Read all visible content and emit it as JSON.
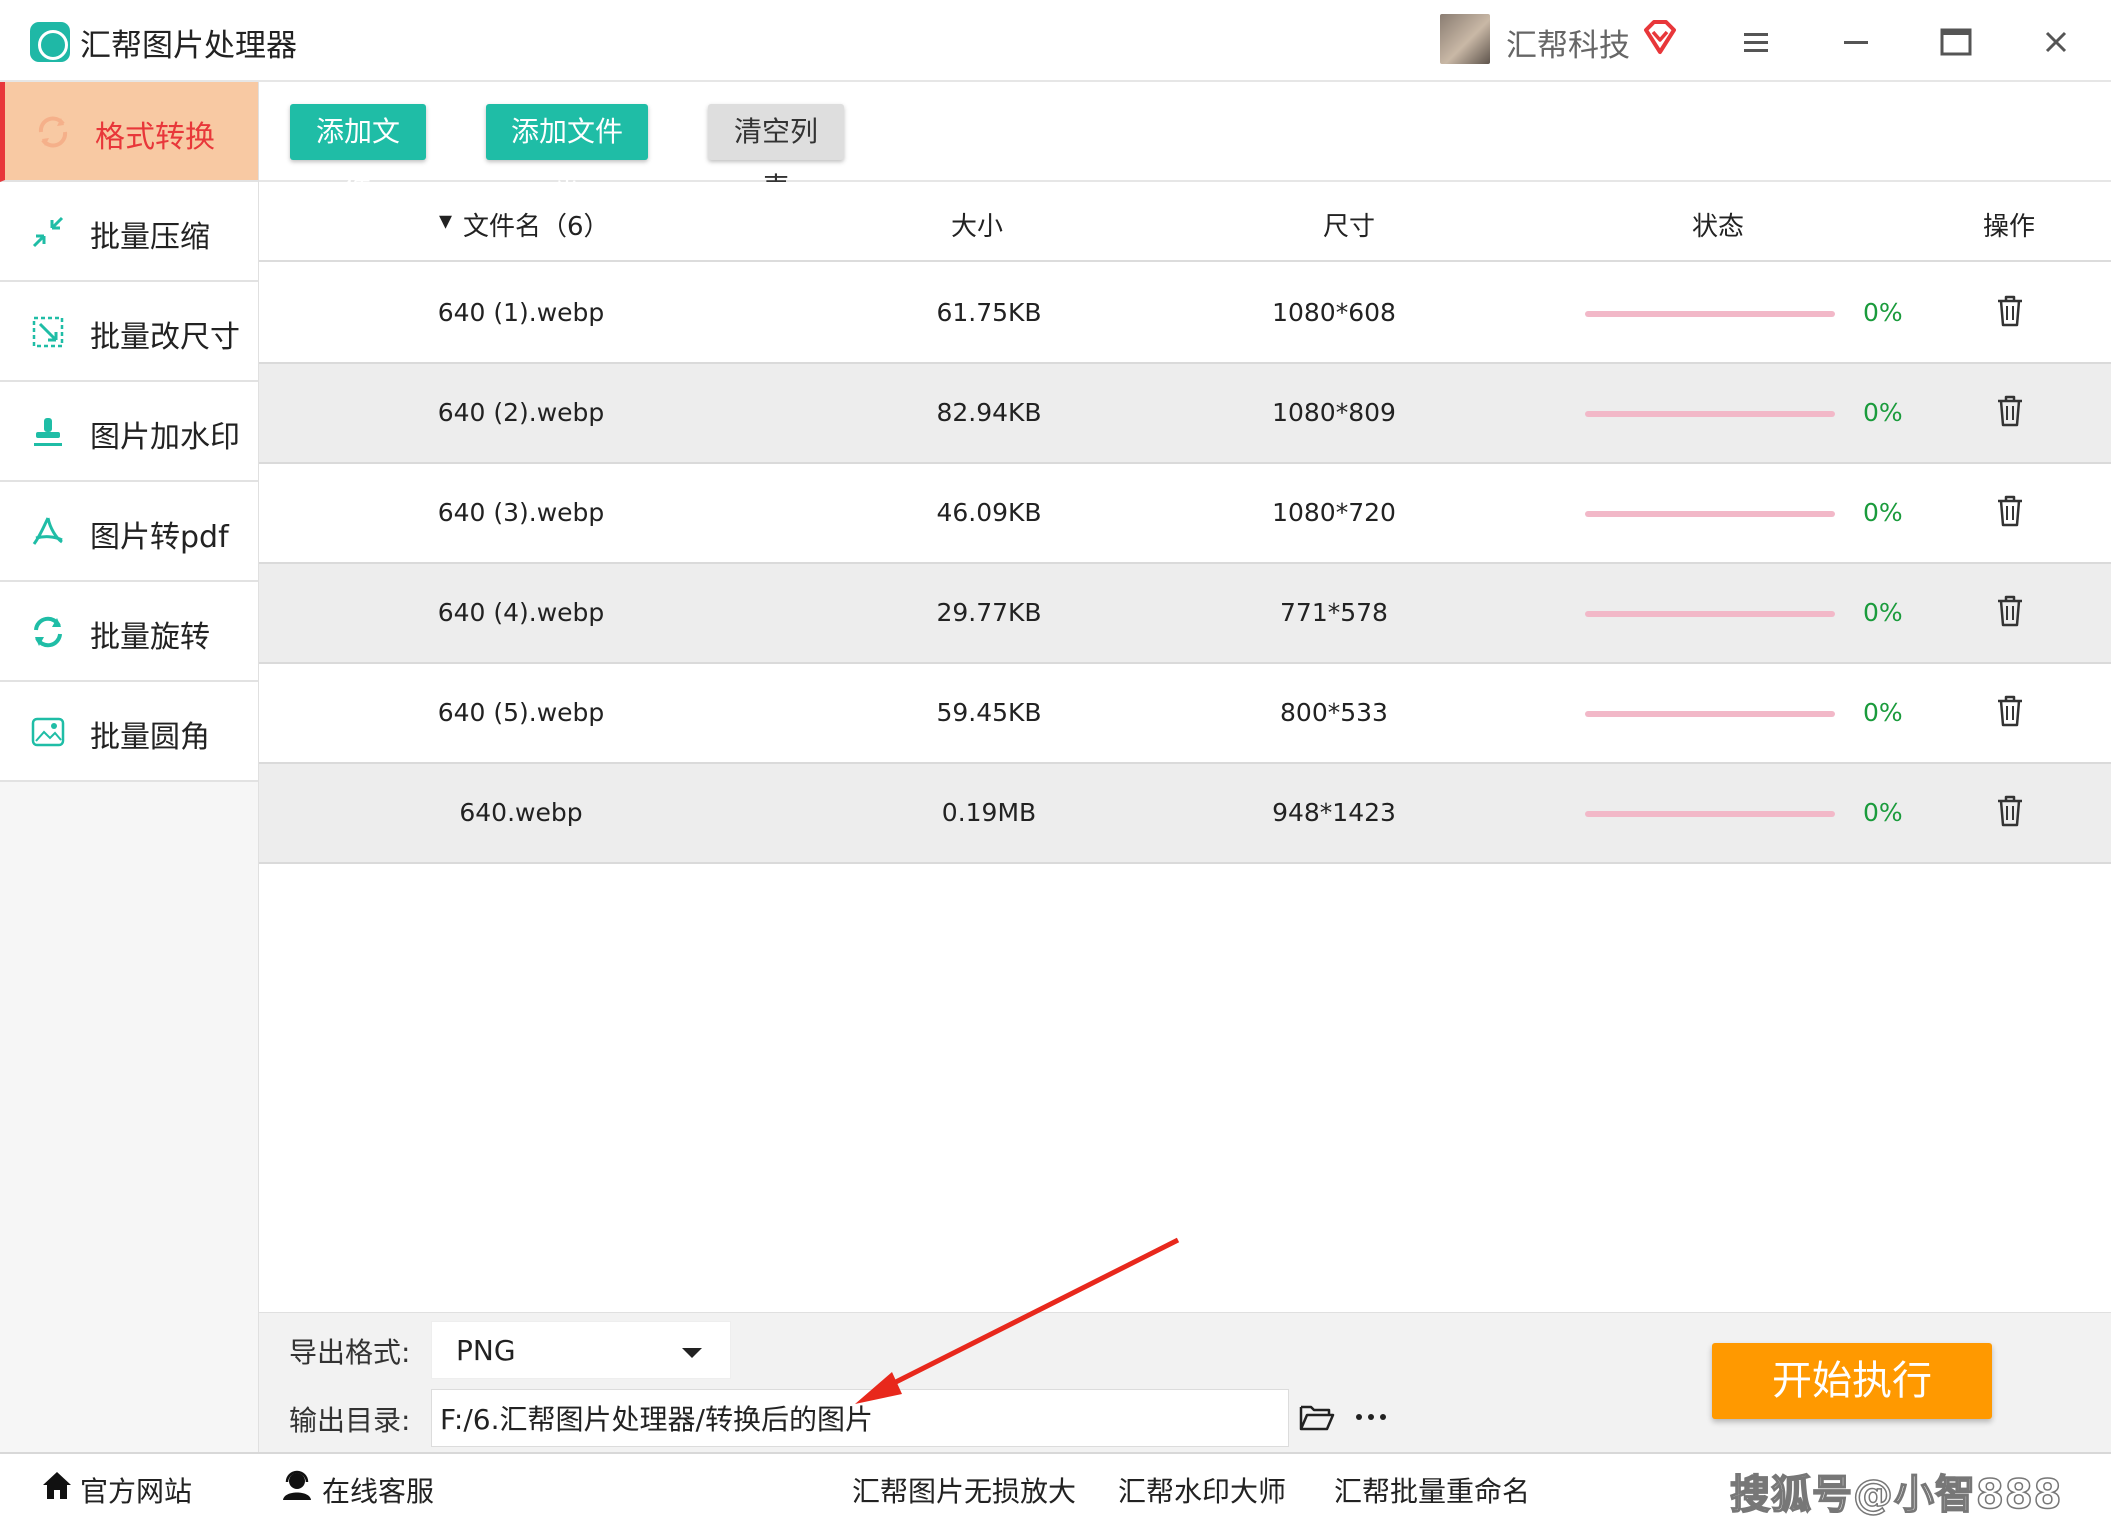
{
  "app": {
    "title": "汇帮图片处理器"
  },
  "user": {
    "name": "汇帮科技"
  },
  "sidebar": {
    "items": [
      {
        "label": "格式转换",
        "icon": "format-convert-icon",
        "active": true
      },
      {
        "label": "批量压缩",
        "icon": "compress-icon"
      },
      {
        "label": "批量改尺寸",
        "icon": "resize-icon"
      },
      {
        "label": "图片加水印",
        "icon": "watermark-stamp-icon"
      },
      {
        "label": "图片转pdf",
        "icon": "pdf-icon"
      },
      {
        "label": "批量旋转",
        "icon": "rotate-icon"
      },
      {
        "label": "批量圆角",
        "icon": "round-corner-icon"
      }
    ]
  },
  "toolbar": {
    "add_file": "添加文件",
    "add_folder": "添加文件夹",
    "clear_list": "清空列表"
  },
  "table": {
    "headers": {
      "filename": "文件名（6）",
      "size": "大小",
      "dimensions": "尺寸",
      "status": "状态",
      "action": "操作"
    },
    "rows": [
      {
        "name": "640 (1).webp",
        "size": "61.75KB",
        "dim": "1080*608",
        "progress": 0,
        "pct": "0%"
      },
      {
        "name": "640 (2).webp",
        "size": "82.94KB",
        "dim": "1080*809",
        "progress": 0,
        "pct": "0%"
      },
      {
        "name": "640 (3).webp",
        "size": "46.09KB",
        "dim": "1080*720",
        "progress": 0,
        "pct": "0%"
      },
      {
        "name": "640 (4).webp",
        "size": "29.77KB",
        "dim": "771*578",
        "progress": 0,
        "pct": "0%"
      },
      {
        "name": "640 (5).webp",
        "size": "59.45KB",
        "dim": "800*533",
        "progress": 0,
        "pct": "0%"
      },
      {
        "name": "640.webp",
        "size": "0.19MB",
        "dim": "948*1423",
        "progress": 0,
        "pct": "0%"
      }
    ]
  },
  "config": {
    "format_label": "导出格式:",
    "format_value": "PNG",
    "output_label": "输出目录:",
    "output_path": "F:/6.汇帮图片处理器/转换后的图片",
    "start_label": "开始执行"
  },
  "footer": {
    "official_site": "官方网站",
    "online_service": "在线客服",
    "link1": "汇帮图片无损放大",
    "link2": "汇帮水印大师",
    "link3": "汇帮批量重命名",
    "watermark": "搜狐号@小智888"
  },
  "colors": {
    "accent": "#1fbda6",
    "active_text": "#e8373a",
    "active_bg": "#f8c9a3",
    "start": "#ff9900",
    "progress_track": "#f2b8c8",
    "percent": "#1a9b3c",
    "arrow": "#e8281c"
  }
}
